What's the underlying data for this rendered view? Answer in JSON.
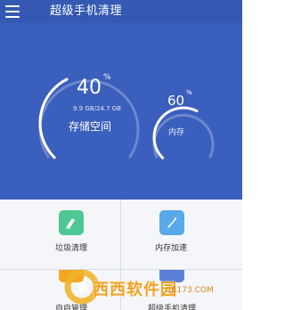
{
  "app": {
    "title": "超级手机清理",
    "primary_color": "#3b5fbc",
    "topbar_color": "#3559b2"
  },
  "storage": {
    "value": "40",
    "unit": "%",
    "detail": "9.9 GB/24.7 GB",
    "label": "存储空间",
    "fraction": 0.4
  },
  "memory": {
    "value": "60",
    "unit": "%",
    "label": "内存",
    "fraction": 0.6
  },
  "tiles": [
    {
      "label": "垃圾清理",
      "icon": "broom-icon",
      "color": "#4fc792"
    },
    {
      "label": "内存加速",
      "icon": "rocket-icon",
      "color": "#58a9e8"
    },
    {
      "label": "自启管理",
      "icon": "startup-icon",
      "color": "#f5a623"
    },
    {
      "label": "超级手机清理",
      "icon": "app-icon",
      "color": "#5b7fd4"
    }
  ],
  "watermark": {
    "brand": "西西软件园",
    "site": "CR173.COM"
  }
}
